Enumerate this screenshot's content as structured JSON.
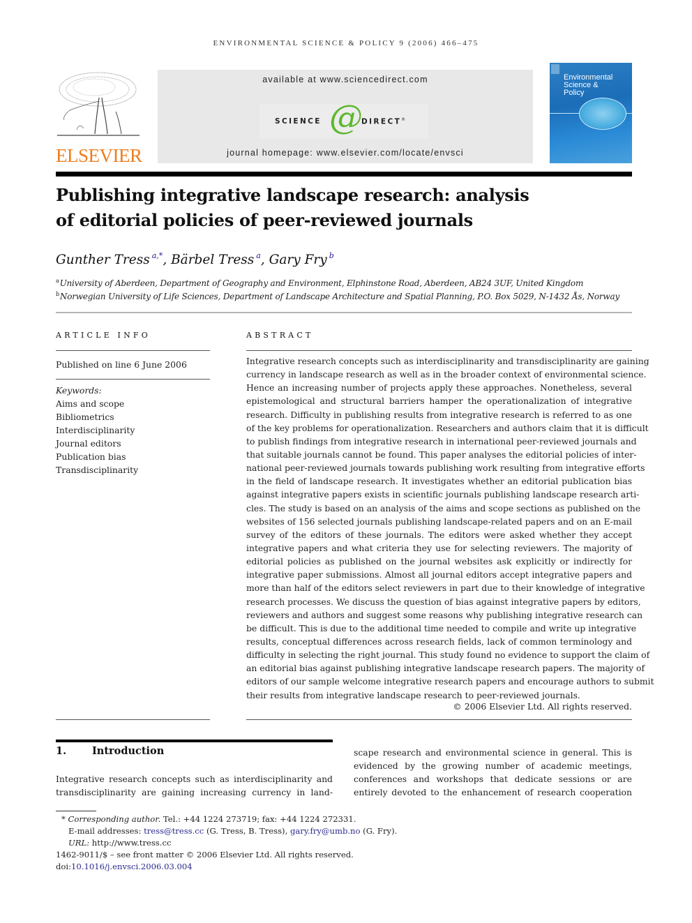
{
  "running_head": "ENVIRONMENTAL SCIENCE & POLICY 9 (2006) 466–475",
  "header": {
    "publisher_logo_text": "ELSEVIER",
    "available_at": "available at www.sciencedirect.com",
    "sciencedirect_left": "SCIENCE",
    "sciencedirect_at": "d",
    "sciencedirect_right": "DIRECT",
    "sciencedirect_reg": "®",
    "journal_homepage": "journal homepage: www.elsevier.com/locate/envsci",
    "cover_title_lines": [
      "Environmental",
      "Science &",
      "Policy"
    ],
    "colors": {
      "elsevier_orange": "#f07c1c",
      "sciencedirect_green": "#5cb82c",
      "cover_blue": "#1c6db8",
      "link_blue": "#2a2a8c"
    }
  },
  "article": {
    "title_lines": [
      "Publishing integrative landscape research: analysis",
      "of editorial policies of peer-reviewed journals"
    ],
    "authors": [
      {
        "name": "Gunther Tress",
        "sup": "a,*",
        "sep": ", "
      },
      {
        "name": "Bärbel Tress",
        "sup": "a",
        "sep": ", "
      },
      {
        "name": "Gary Fry",
        "sup": "b",
        "sep": ""
      }
    ],
    "affiliations": [
      {
        "mark": "a",
        "text": "University of Aberdeen, Department of Geography and Environment, Elphinstone Road, Aberdeen, AB24 3UF, United Kingdom"
      },
      {
        "mark": "b",
        "text": "Norwegian University of Life Sciences, Department of Landscape Architecture and Spatial Planning, P.O. Box 5029, N-1432 Ås, Norway"
      }
    ]
  },
  "article_info": {
    "label": "ARTICLE INFO",
    "published": "Published on line 6 June 2006",
    "keywords_label": "Keywords:",
    "keywords": [
      "Aims and scope",
      "Bibliometrics",
      "Interdisciplinarity",
      "Journal editors",
      "Publication bias",
      "Transdisciplinarity"
    ]
  },
  "abstract": {
    "label": "ABSTRACT",
    "lines": [
      "Integrative research concepts such as interdisciplinarity and transdisciplinarity are gaining",
      "currency in landscape research as well as in the broader context of environmental science.",
      "Hence an increasing number of projects apply these approaches. Nonetheless, several",
      "epistemological and structural barriers hamper the operationalization of integrative",
      "research. Difficulty in publishing results from integrative research is referred to as one",
      "of the key problems for operationalization. Researchers and authors claim that it is difficult",
      "to publish findings from integrative research in international peer-reviewed journals and",
      "that suitable journals cannot be found. This paper analyses the editorial policies of inter-",
      "national peer-reviewed journals towards publishing work resulting from integrative efforts",
      "in the field of landscape research. It investigates whether an editorial publication bias",
      "against integrative papers exists in scientific journals publishing landscape research arti-",
      "cles. The study is based on an analysis of the aims and scope sections as published on the",
      "websites of 156 selected journals publishing landscape-related papers and on an E-mail",
      "survey of the editors of these journals. The editors were asked whether they accept",
      "integrative papers and what criteria they use for selecting reviewers. The majority of",
      "editorial policies as published on the journal websites ask explicitly or indirectly for",
      "integrative paper submissions. Almost all journal editors accept integrative papers and",
      "more than half of the editors select reviewers in part due to their knowledge of integrative",
      "research processes. We discuss the question of bias against integrative papers by editors,",
      "reviewers and authors and suggest some reasons why publishing integrative research can",
      "be difficult. This is due to the additional time needed to compile and write up integrative",
      "results, conceptual differences across research fields, lack of common terminology and",
      "difficulty in selecting the right journal. This study found no evidence to support the claim of",
      "an editorial bias against publishing integrative landscape research papers. The majority of",
      "editors of our sample welcome integrative research papers and encourage authors to submit",
      "their results from integrative landscape research to peer-reviewed journals."
    ],
    "copyright": "© 2006 Elsevier Ltd. All rights reserved."
  },
  "introduction": {
    "number": "1.",
    "heading": "Introduction",
    "left_lines": [
      "Integrative research concepts such as interdisciplinarity and",
      "transdisciplinarity are gaining increasing currency in land-"
    ],
    "right_lines": [
      "scape research and environmental science in general. This is",
      "evidenced by the growing number of academic meetings,",
      "conferences and workshops that dedicate sessions or are",
      "entirely devoted to the enhancement of research cooperation"
    ]
  },
  "footnotes": {
    "corresponding_mark": "*",
    "corresponding_label": "Corresponding author.",
    "corresponding_contact": " Tel.: +44 1224 273719; fax: +44 1224 272331.",
    "email_label": "E-mail addresses: ",
    "email_1": "tress@tress.cc",
    "email_1_names": " (G. Tress, B. Tress), ",
    "email_2": "gary.fry@umb.no",
    "email_2_names": " (G. Fry).",
    "url_label": "URL:",
    "url": " http://www.tress.cc",
    "issn_line": "1462-9011/$ – see front matter © 2006 Elsevier Ltd. All rights reserved.",
    "doi_label": "doi:",
    "doi": "10.1016/j.envsci.2006.03.004"
  }
}
